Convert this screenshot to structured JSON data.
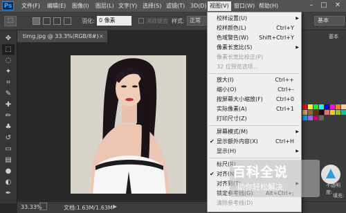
{
  "menubar": {
    "logo": "Ps",
    "items": [
      "文件(F)",
      "编辑(E)",
      "图像(I)",
      "图层(L)",
      "文字(Y)",
      "选择(S)",
      "滤镜(T)",
      "3D(D)",
      "视图(V)",
      "窗口(W)",
      "帮助(H)"
    ],
    "active_item": "视图(V)"
  },
  "options": {
    "feather_label": "羽化:",
    "feather_value": "0 像素",
    "antialias_label": "消除锯齿",
    "style_label": "样式:",
    "style_value": "正常",
    "workspace_value": "基本"
  },
  "document": {
    "tab_title": "timg.jpg @ 33.3%(RGB/8#)",
    "zoom": "33.33%",
    "doc_info": "文档:1.63M/1.63M"
  },
  "view_menu": {
    "items": [
      {
        "label": "校样设置(U)",
        "shortcut": "",
        "submenu": true,
        "checked": false,
        "disabled": false
      },
      {
        "label": "校样颜色(L)",
        "shortcut": "Ctrl+Y",
        "submenu": false,
        "checked": false,
        "disabled": false
      },
      {
        "label": "色域警告(W)",
        "shortcut": "Shift+Ctrl+Y",
        "submenu": false,
        "checked": false,
        "disabled": false
      },
      {
        "label": "像素长宽比(S)",
        "shortcut": "",
        "submenu": true,
        "checked": false,
        "disabled": false
      },
      {
        "label": "像素长宽比校正(P)",
        "shortcut": "",
        "submenu": false,
        "checked": false,
        "disabled": true
      },
      {
        "label": "32 位预览选项...",
        "shortcut": "",
        "submenu": false,
        "checked": false,
        "disabled": true
      },
      {
        "label": "放大(I)",
        "shortcut": "Ctrl++",
        "submenu": false,
        "checked": false,
        "disabled": false
      },
      {
        "label": "缩小(O)",
        "shortcut": "Ctrl+-",
        "submenu": false,
        "checked": false,
        "disabled": false
      },
      {
        "label": "按屏幕大小缩放(F)",
        "shortcut": "Ctrl+0",
        "submenu": false,
        "checked": false,
        "disabled": false
      },
      {
        "label": "实际像素(A)",
        "shortcut": "Ctrl+1",
        "submenu": false,
        "checked": false,
        "disabled": false
      },
      {
        "label": "打印尺寸(Z)",
        "shortcut": "",
        "submenu": false,
        "checked": false,
        "disabled": false
      },
      {
        "label": "屏幕模式(M)",
        "shortcut": "",
        "submenu": true,
        "checked": false,
        "disabled": false
      },
      {
        "label": "显示额外内容(X)",
        "shortcut": "Ctrl+H",
        "submenu": false,
        "checked": true,
        "disabled": false
      },
      {
        "label": "显示(H)",
        "shortcut": "",
        "submenu": true,
        "checked": false,
        "disabled": false
      },
      {
        "label": "标尺(R)",
        "shortcut": "",
        "submenu": false,
        "checked": false,
        "disabled": false
      },
      {
        "label": "对齐(N)",
        "shortcut": "",
        "submenu": false,
        "checked": true,
        "disabled": false
      },
      {
        "label": "对齐到(T)",
        "shortcut": "",
        "submenu": true,
        "checked": false,
        "disabled": false
      },
      {
        "label": "锁定参考线(G)",
        "shortcut": "Alt+Ctrl+;",
        "submenu": false,
        "checked": false,
        "disabled": false
      },
      {
        "label": "清除参考线(D)",
        "shortcut": "",
        "submenu": false,
        "checked": false,
        "disabled": true
      }
    ]
  },
  "right_panel": {
    "label_top": "基本",
    "opacity_label": "不透明度:",
    "fill_label": "填充:"
  },
  "watermark": {
    "title": "百科全说",
    "subtitle": "助你轻松解决"
  },
  "swatches": [
    "#ff0000",
    "#ffff00",
    "#00ff00",
    "#00ffff",
    "#0000ff",
    "#ff00ff",
    "#ff8000",
    "#ffcc99",
    "#cc9966",
    "#996633",
    "#663300",
    "#330000",
    "#ff6666",
    "#ffcc00",
    "#99cc00",
    "#00cc99",
    "#0099ff",
    "#9966ff",
    "#cc0066",
    "#666666"
  ]
}
